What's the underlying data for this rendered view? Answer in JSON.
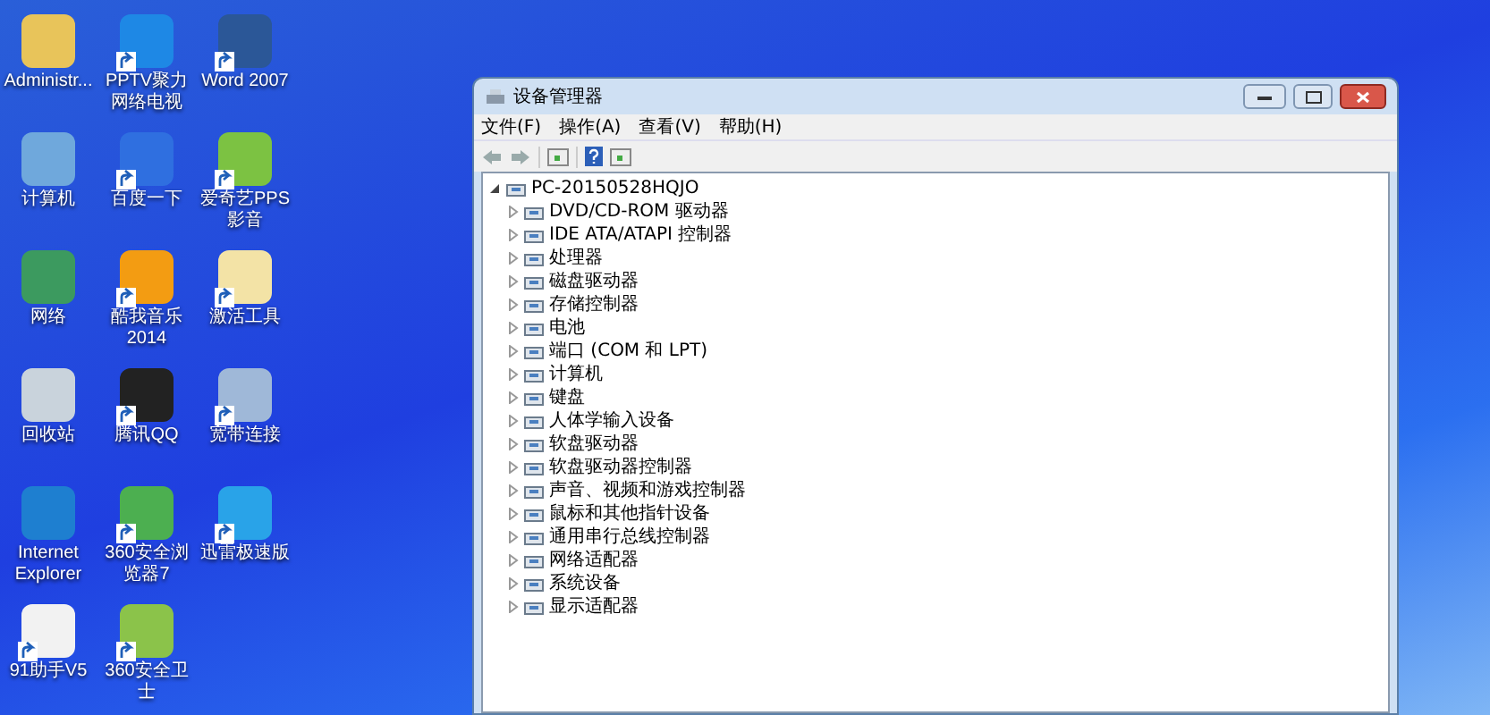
{
  "desktop_icons": [
    {
      "label": "Administr...",
      "shortcut": false,
      "color": "#e8c45a"
    },
    {
      "label": "PPTV聚力网络电视",
      "shortcut": true,
      "color": "#1e88e5"
    },
    {
      "label": "Word 2007",
      "shortcut": true,
      "color": "#2b5797"
    },
    {
      "label": "计算机",
      "shortcut": false,
      "color": "#6fa8dc"
    },
    {
      "label": "百度一下",
      "shortcut": true,
      "color": "#2f6fe0"
    },
    {
      "label": "爱奇艺PPS 影音",
      "shortcut": true,
      "color": "#7cc242"
    },
    {
      "label": "网络",
      "shortcut": false,
      "color": "#3c9a5f"
    },
    {
      "label": "酷我音乐 2014",
      "shortcut": true,
      "color": "#f39c12"
    },
    {
      "label": "激活工具",
      "shortcut": true,
      "color": "#f3e3a6"
    },
    {
      "label": "回收站",
      "shortcut": false,
      "color": "#c9d3dc"
    },
    {
      "label": "腾讯QQ",
      "shortcut": true,
      "color": "#222222"
    },
    {
      "label": "宽带连接",
      "shortcut": true,
      "color": "#9fb8d8"
    },
    {
      "label": "Internet Explorer",
      "shortcut": false,
      "color": "#1e7fd0"
    },
    {
      "label": "360安全浏览器7",
      "shortcut": true,
      "color": "#4caf50"
    },
    {
      "label": "迅雷极速版",
      "shortcut": true,
      "color": "#29a3e8"
    },
    {
      "label": "91助手V5",
      "shortcut": true,
      "color": "#f2f2f2"
    },
    {
      "label": "360安全卫士",
      "shortcut": true,
      "color": "#8bc34a"
    }
  ],
  "window": {
    "title": "设备管理器",
    "menu": [
      "文件(F)",
      "操作(A)",
      "查看(V)",
      "帮助(H)"
    ],
    "tree": {
      "label": "PC-20150528HQJO",
      "expanded": true,
      "children": [
        {
          "label": "DVD/CD-ROM 驱动器",
          "expanded": false
        },
        {
          "label": "IDE ATA/ATAPI 控制器",
          "expanded": false
        },
        {
          "label": "处理器",
          "expanded": false
        },
        {
          "label": "磁盘驱动器",
          "expanded": false
        },
        {
          "label": "存储控制器",
          "expanded": false
        },
        {
          "label": "电池",
          "expanded": false
        },
        {
          "label": "端口 (COM 和 LPT)",
          "expanded": false
        },
        {
          "label": "计算机",
          "expanded": false
        },
        {
          "label": "键盘",
          "expanded": false
        },
        {
          "label": "人体学输入设备",
          "expanded": false
        },
        {
          "label": "软盘驱动器",
          "expanded": false
        },
        {
          "label": "软盘驱动器控制器",
          "expanded": false
        },
        {
          "label": "声音、视频和游戏控制器",
          "expanded": false
        },
        {
          "label": "鼠标和其他指针设备",
          "expanded": false
        },
        {
          "label": "通用串行总线控制器",
          "expanded": false
        },
        {
          "label": "网络适配器",
          "expanded": false
        },
        {
          "label": "系统设备",
          "expanded": false
        },
        {
          "label": "显示适配器",
          "expanded": false
        }
      ]
    }
  }
}
